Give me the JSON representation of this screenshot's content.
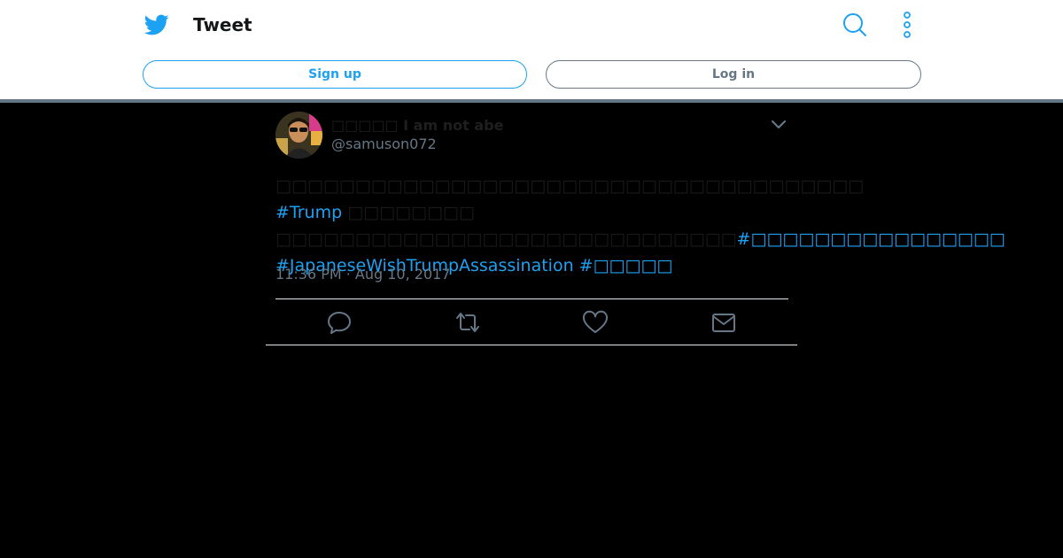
{
  "header": {
    "title": "Tweet",
    "icons": [
      "twitter-bird-icon",
      "search-icon",
      "more-vertical-icon"
    ],
    "signup_label": "Sign up",
    "login_label": "Log in"
  },
  "tweet": {
    "display_name": "□□□□□ I am not abe",
    "handle": "@samuson072",
    "text_part1": "□□□□□□□□□□□□□□□□□□□□□□□□□□□□□□□□□□□□□ ",
    "hashtag1": "#Trump",
    "text_part2": " □□□□□□□□ □□□□□□□□□□□□□□□□□□□□□□□□□□□□□",
    "hashtag2": "#□□□□□□□□□□□□□□□□",
    "hashtag3": "#JapaneseWishTrumpAssassination",
    "hashtag4": "#□□□□□",
    "timestamp": "11:36 PM · Aug 10, 2017",
    "actions": [
      "reply-icon",
      "retweet-icon",
      "like-icon",
      "direct-message-icon"
    ]
  },
  "colors": {
    "accent": "#1da1f2",
    "muted": "#657786",
    "background": "#000000"
  }
}
